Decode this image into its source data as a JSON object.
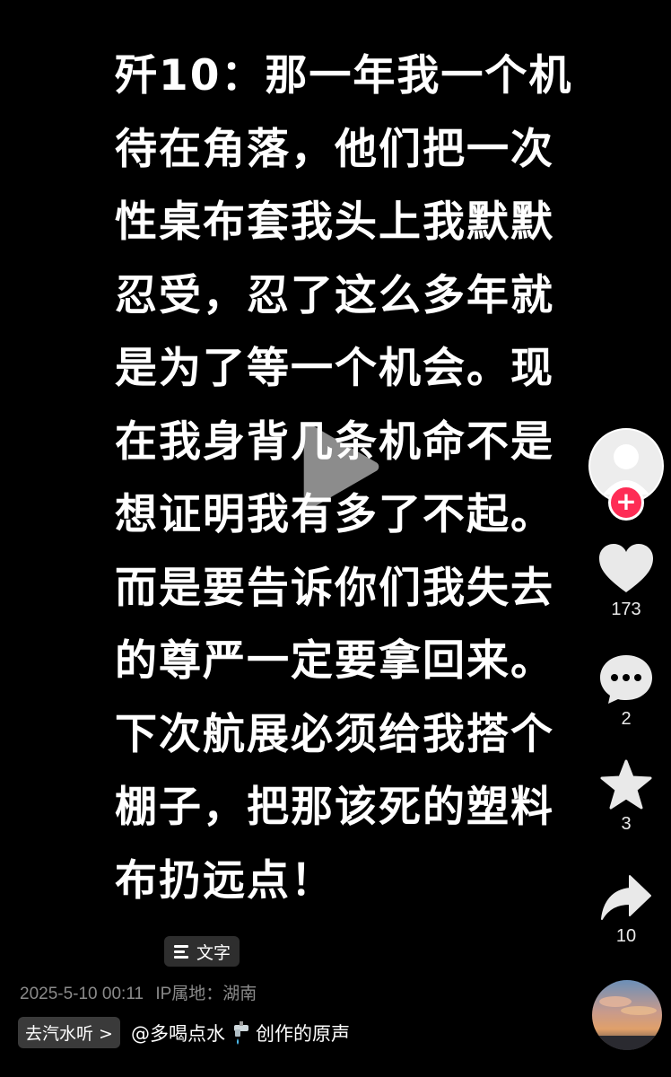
{
  "post": {
    "lines": [
      "歼10：那一年我一个机",
      "待在角落，他们把一次",
      "性桌布套我头上我默默",
      "忍受，忍了这么多年就",
      "是为了等一个机会。现",
      "在我身背几条机命不是",
      "想证明我有多了不起。",
      "而是要告诉你们我失去",
      "的尊严一定要拿回来。",
      "下次航展必须给我搭个",
      "棚子，把那该死的塑料",
      "布扔远点！"
    ]
  },
  "sidebar": {
    "follow_symbol": "+",
    "likes": "173",
    "comments": "2",
    "favorites": "3",
    "shares": "10"
  },
  "text_tag": {
    "label": "文字"
  },
  "meta": {
    "datetime": "2025-5-10 00:11",
    "location": "IP属地：湖南"
  },
  "bottom": {
    "chip_label": "去汽水听 >",
    "sound_prefix": "@多喝点水",
    "sound_suffix": "创作的原声"
  },
  "icons": {
    "play": "play-icon",
    "heart": "heart-icon",
    "comment": "comment-icon",
    "star": "star-icon",
    "share": "share-icon",
    "text": "text-lines-icon",
    "faucet": "faucet-icon"
  },
  "colors": {
    "background": "#000000",
    "follow": "#fe2c55",
    "meta_text": "#8a8a8a"
  }
}
